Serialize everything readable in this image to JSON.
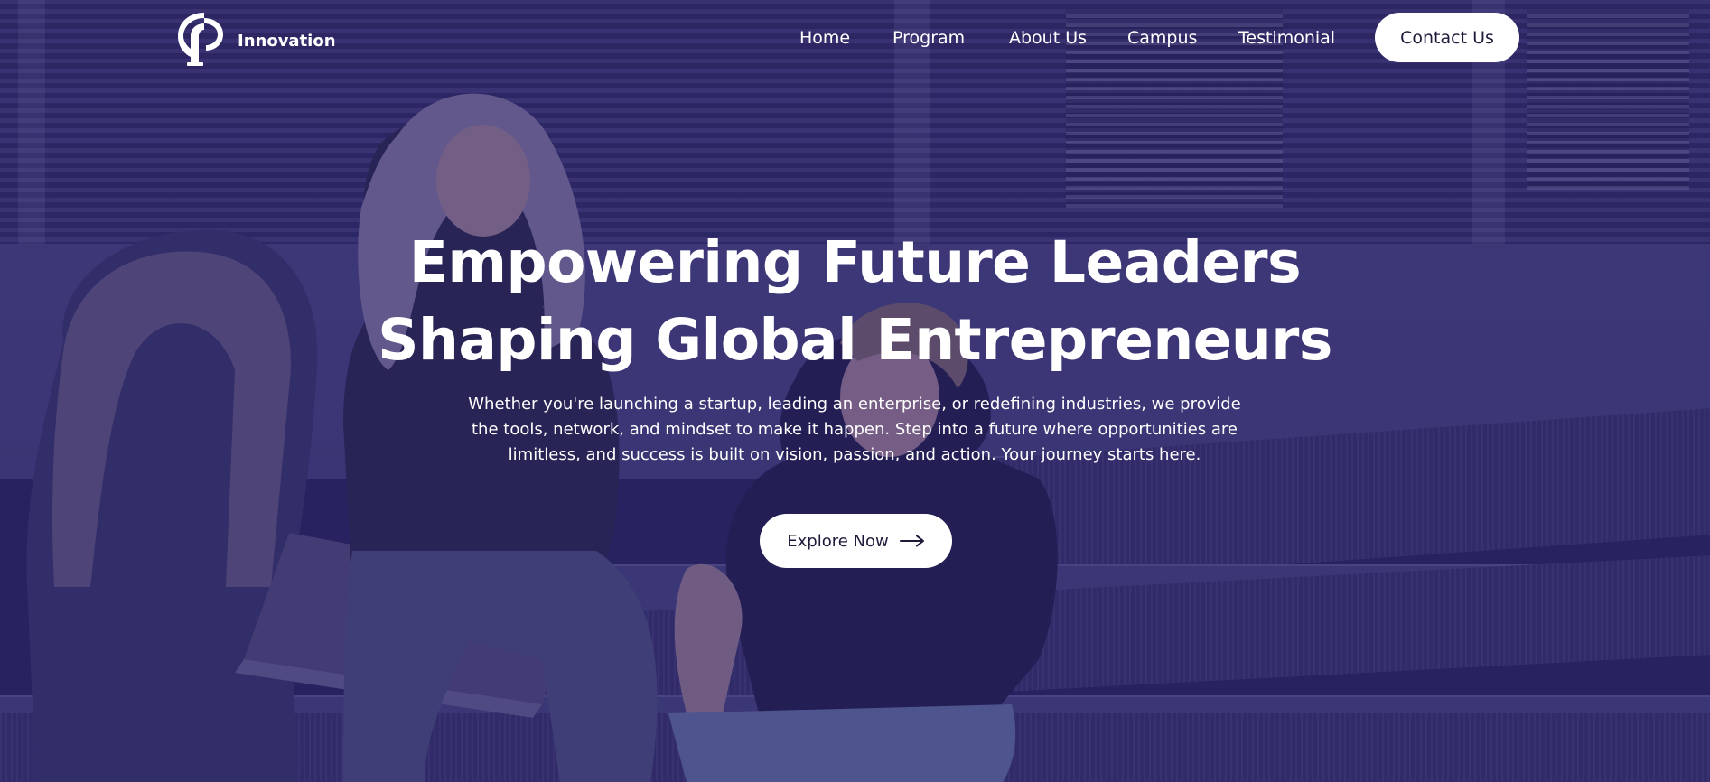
{
  "brand": {
    "name": "Innovation",
    "logo_icon": "p-logo-icon"
  },
  "nav": {
    "items": [
      {
        "label": "Home"
      },
      {
        "label": "Program"
      },
      {
        "label": "About Us"
      },
      {
        "label": "Campus"
      },
      {
        "label": "Testimonial"
      }
    ],
    "cta_label": "Contact Us"
  },
  "hero": {
    "headline_line1": "Empowering Future Leaders",
    "headline_line2": "Shaping Global Entrepreneurs",
    "subtitle": "Whether you're launching a startup, leading an enterprise, or redefining industries, we provide the tools, network, and mindset to make it happen. Step into a future where opportunities are limitless, and success is built on vision, passion, and action. Your journey starts here.",
    "cta_label": "Explore Now",
    "cta_icon": "arrow-right-icon"
  },
  "colors": {
    "overlay": "#2a2270",
    "button_bg": "#ffffff",
    "button_text": "#1e1b3a",
    "text": "#ffffff"
  }
}
